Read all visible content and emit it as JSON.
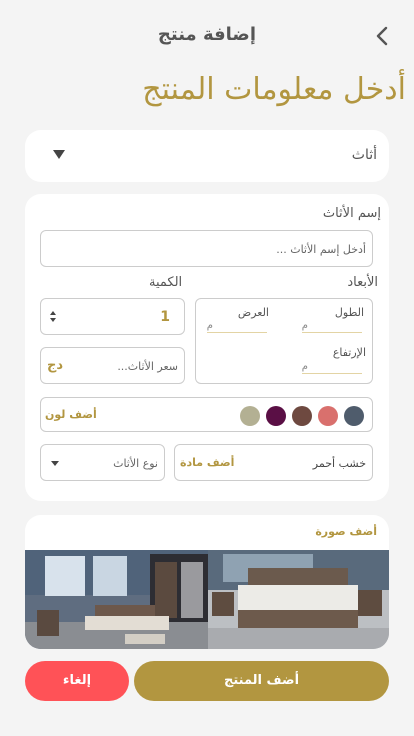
{
  "header": {
    "title": "إضافة منتج"
  },
  "page": {
    "heading": "أدخل معلومات المنتج"
  },
  "category": {
    "selected": "أثاث"
  },
  "form": {
    "name_label": "إسم الأثاث",
    "name_placeholder": "أدخل إسم الأثاث ...",
    "quantity_label": "الكمية",
    "quantity_value": "1",
    "dimensions_label": "الأبعاد",
    "length_label": "الطول",
    "width_label": "العرض",
    "height_label": "الإرتفاع",
    "unit": "م",
    "price_placeholder": "سعر الأثاث...",
    "currency": "دج",
    "add_color": "أضف لون",
    "colors": [
      "#4f5c6c",
      "#d9706d",
      "#6e4940",
      "#5a0f45",
      "#b3b093"
    ],
    "type_placeholder": "نوع الأثاث",
    "material_value": "خشب أحمر",
    "add_material": "أضف مادة"
  },
  "photos": {
    "add_label": "أضف صورة"
  },
  "actions": {
    "add_product": "أضف المنتج",
    "cancel": "إلغاء"
  },
  "theme": {
    "accent": "#b29640",
    "danger": "#ff5257"
  }
}
